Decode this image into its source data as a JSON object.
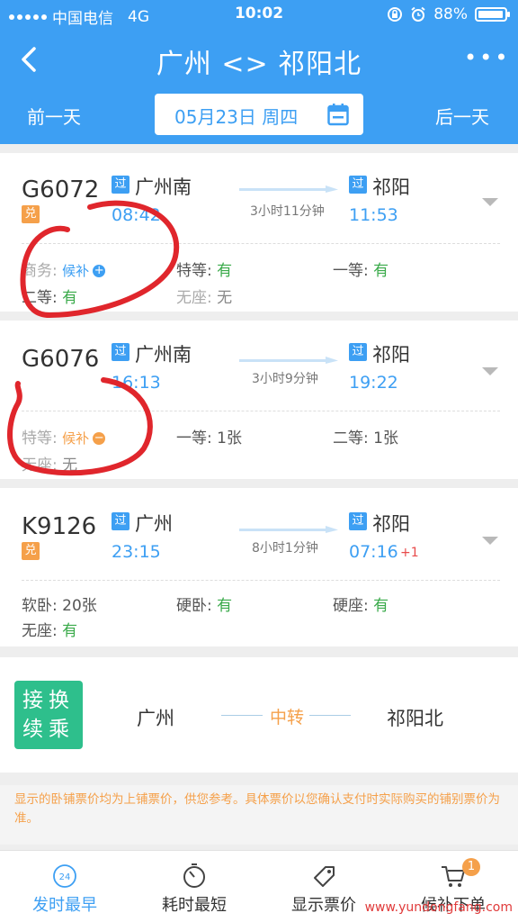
{
  "status_bar": {
    "carrier": "中国电信",
    "network": "4G",
    "time": "10:02",
    "battery": "88%"
  },
  "nav": {
    "title": "广州 <> 祁阳北"
  },
  "datebar": {
    "prev": "前一天",
    "date": "05月23日 周四",
    "next": "后一天"
  },
  "trains": [
    {
      "number": "G6072",
      "exchange_badge": "兑",
      "from_badge": "过",
      "from": "广州南",
      "depart": "08:42",
      "duration": "3小时11分钟",
      "to_badge": "过",
      "to": "祁阳",
      "arrive": "11:53",
      "seats": [
        {
          "label": "商务:",
          "value": "候补"
        },
        {
          "label": "特等:",
          "value": "有"
        },
        {
          "label": "一等:",
          "value": "有"
        },
        {
          "label": "二等:",
          "value": "有"
        },
        {
          "label": "无座:",
          "value": "无"
        }
      ]
    },
    {
      "number": "G6076",
      "from_badge": "过",
      "from": "广州南",
      "depart": "16:13",
      "duration": "3小时9分钟",
      "to_badge": "过",
      "to": "祁阳",
      "arrive": "19:22",
      "seats": [
        {
          "label": "特等:",
          "value": "候补"
        },
        {
          "label": "一等:",
          "value": "1张"
        },
        {
          "label": "二等:",
          "value": "1张"
        },
        {
          "label": "无座:",
          "value": "无"
        }
      ]
    },
    {
      "number": "K9126",
      "exchange_badge": "兑",
      "from_badge": "过",
      "from": "广州",
      "depart": "23:15",
      "duration": "8小时1分钟",
      "to_badge": "过",
      "to": "祁阳",
      "arrive": "07:16",
      "plus_day": "+1",
      "seats": [
        {
          "label": "软卧:",
          "value": "20张"
        },
        {
          "label": "硬卧:",
          "value": "有"
        },
        {
          "label": "硬座:",
          "value": "有"
        },
        {
          "label": "无座:",
          "value": "有"
        }
      ]
    }
  ],
  "transfer": {
    "badge_line1": "接换",
    "badge_line2": "续乘",
    "from": "广州",
    "mid": "中转",
    "to": "祁阳北"
  },
  "notice": "显示的卧铺票价均为上铺票价，供您参考。具体票价以您确认支付时实际购买的铺别票价为准。",
  "bottom_tabs": [
    {
      "label": "发时最早",
      "icon": "clock-24-icon",
      "icon_text": "24"
    },
    {
      "label": "耗时最短",
      "icon": "stopwatch-icon"
    },
    {
      "label": "显示票价",
      "icon": "price-tag-icon"
    },
    {
      "label": "候补下单",
      "icon": "cart-icon",
      "badge": "1"
    }
  ],
  "watermark": "www.yundongfang.com",
  "colors": {
    "primary": "#3d9ff3",
    "available": "#3aaa4a",
    "accent": "#f5a04a",
    "transfer": "#2ebf8c",
    "annotation": "#e0262c"
  }
}
